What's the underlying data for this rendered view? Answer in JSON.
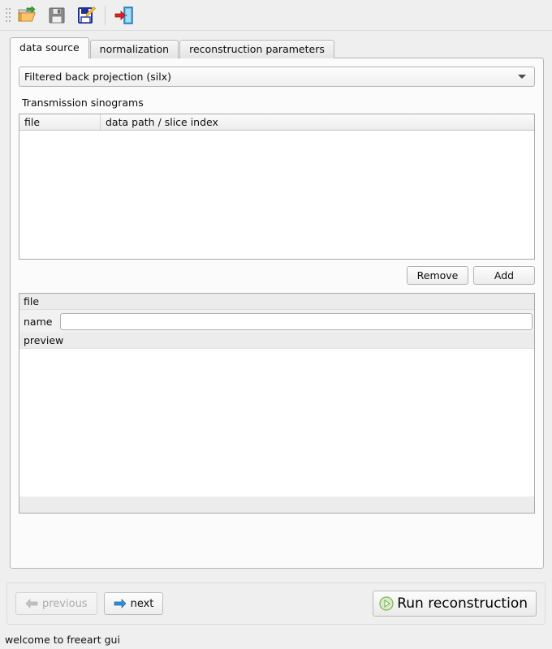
{
  "toolbar": {
    "items": [
      {
        "name": "open-icon",
        "title": "Open"
      },
      {
        "name": "save-icon",
        "title": "Save"
      },
      {
        "name": "save-as-icon",
        "title": "Save as"
      },
      {
        "name": "exit-icon",
        "title": "Exit"
      }
    ]
  },
  "tabs": [
    {
      "label": "data source",
      "active": true
    },
    {
      "label": "normalization",
      "active": false
    },
    {
      "label": "reconstruction parameters",
      "active": false
    }
  ],
  "reconstruction_method": {
    "selected": "Filtered back projection (silx)"
  },
  "sinograms": {
    "section_label": "Transmission sinograms",
    "columns": [
      "file",
      "data path / slice index"
    ],
    "rows": [],
    "remove_label": "Remove",
    "add_label": "Add"
  },
  "file_group": {
    "title": "file",
    "name_label": "name",
    "name_value": "",
    "name_placeholder": "",
    "preview_label": "preview"
  },
  "nav": {
    "previous_label": "previous",
    "next_label": "next",
    "run_label": "Run reconstruction"
  },
  "status": {
    "message": "welcome to freeart gui"
  },
  "colors": {
    "window_bg": "#efefef",
    "panel_bg": "#fbfbfb",
    "field_bg": "#ffffff",
    "border": "#b6b6b6",
    "accent_green": "#77bb55",
    "accent_blue": "#3a8ed0",
    "arrow_red": "#e02020"
  }
}
